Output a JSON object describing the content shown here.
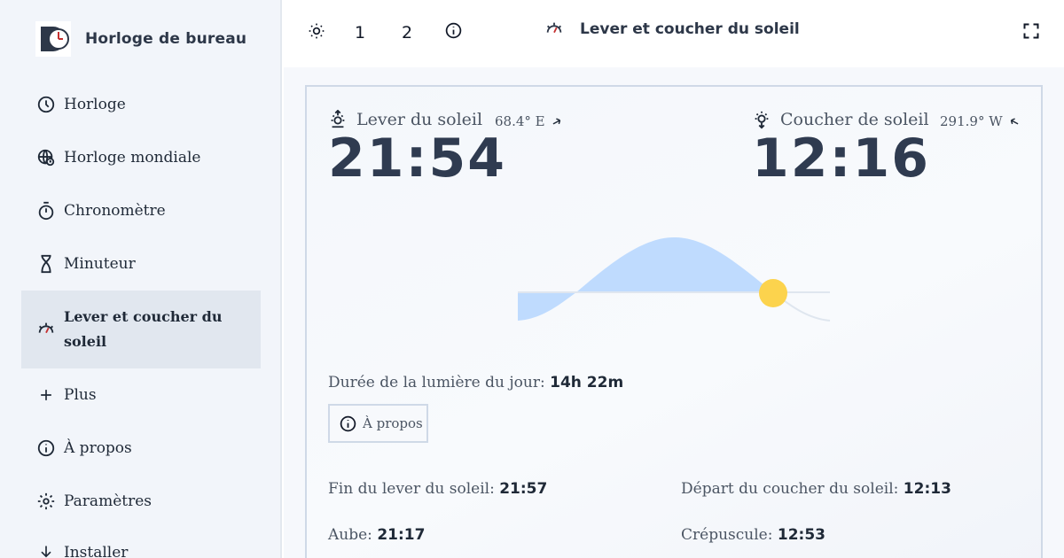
{
  "app": {
    "title": "Horloge de bureau"
  },
  "sidebar": {
    "items": [
      {
        "label": "Horloge",
        "icon": "clock-icon"
      },
      {
        "label": "Horloge mondiale",
        "icon": "world-clock-icon"
      },
      {
        "label": "Chronomètre",
        "icon": "stopwatch-icon"
      },
      {
        "label": "Minuteur",
        "icon": "hourglass-icon"
      },
      {
        "label": "Lever et coucher du soleil",
        "icon": "sunrise-sunset-icon",
        "active": true
      },
      {
        "label": "Plus",
        "icon": "plus-icon"
      },
      {
        "label": "À propos",
        "icon": "info-icon"
      },
      {
        "label": "Paramètres",
        "icon": "gear-icon"
      },
      {
        "label": "Installer",
        "icon": "download-icon"
      }
    ]
  },
  "topbar": {
    "buttons": [
      "1",
      "2"
    ],
    "title": "Lever et coucher du soleil"
  },
  "sun": {
    "sunrise_label": "Lever du soleil",
    "sunrise_azimuth": "68.4° E",
    "sunrise_time": "21:54",
    "sunset_label": "Coucher de soleil",
    "sunset_azimuth": "291.9° W",
    "sunset_time": "12:16",
    "daylight_label": "Durée de la lumière du jour:",
    "daylight_value": "14h 22m",
    "about_label": "À propos",
    "details": [
      {
        "label": "Fin du lever du soleil:",
        "value": "21:57"
      },
      {
        "label": "Départ du coucher du soleil:",
        "value": "12:13"
      },
      {
        "label": "Aube:",
        "value": "21:17"
      },
      {
        "label": "Crépuscule:",
        "value": "12:53"
      }
    ]
  },
  "colors": {
    "accent": "#c53030",
    "sun": "#fcd34d",
    "daylight_fill": "#bfdbfe",
    "active_bg": "#e1e7ef"
  }
}
